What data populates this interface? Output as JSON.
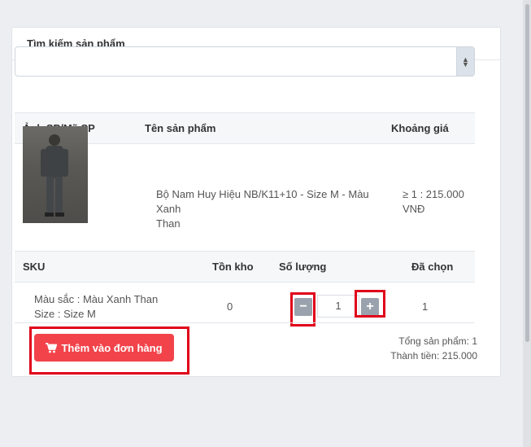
{
  "panel": {
    "title": "Tìm kiếm sản phẩm"
  },
  "search_select": {
    "value": "",
    "arrow_up": "▲",
    "arrow_down": "▼"
  },
  "product_table": {
    "headers": {
      "image_code": "Ảnh SP/Mã SP",
      "name": "Tên sản phẩm",
      "price_range": "Khoảng giá"
    },
    "row": {
      "name_line1": "Bộ Nam Huy Hiệu NB/K11+10 - Size M - Màu Xanh",
      "name_line2": "Than",
      "price_line1": "≥ 1 : 215.000",
      "price_line2": "VNĐ"
    }
  },
  "sku_table": {
    "headers": {
      "sku": "SKU",
      "stock": "Tồn kho",
      "quantity": "Số lượng",
      "selected": "Đã chọn"
    },
    "row": {
      "color": "Màu sắc : Màu Xanh Than",
      "size": "Size : Size M",
      "stock": "0",
      "quantity": "1",
      "selected": "1",
      "minus_label": "−",
      "plus_label": "+"
    }
  },
  "actions": {
    "add_to_order_label": "Thêm vào đơn hàng",
    "cart_icon": "cart-icon"
  },
  "summary": {
    "total_products": "Tổng sản phẩm: 1",
    "total_amount": "Thành tiền: 215.000"
  },
  "colors": {
    "accent_red": "#f2434a",
    "highlight_box": "#e0001a",
    "stepper": "#9aa3ad"
  }
}
